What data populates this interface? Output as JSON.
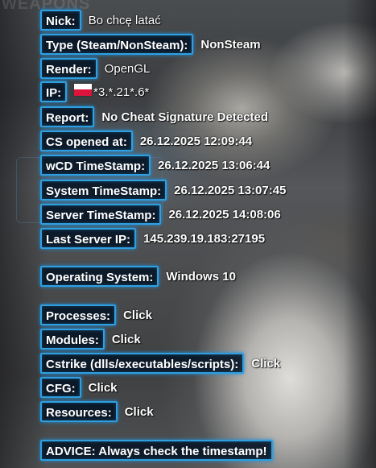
{
  "rows": {
    "nick": {
      "label": "Nick:",
      "value": "Bo chcę latać"
    },
    "type": {
      "label": "Type (Steam/NonSteam):",
      "value": "NonSteam"
    },
    "render": {
      "label": "Render:",
      "value": "OpenGL"
    },
    "ip": {
      "label": "IP:",
      "value": "*3.*.21*.6*",
      "flag": "poland-flag-icon"
    },
    "report": {
      "label": "Report:",
      "value": "No Cheat Signature Detected"
    },
    "cs_opened": {
      "label": "CS opened at:",
      "value": "26.12.2025 12:09:44"
    },
    "wcd_timestamp": {
      "label": "wCD TimeStamp:",
      "value": "26.12.2025 13:06:44"
    },
    "system_timestamp": {
      "label": "System TimeStamp:",
      "value": "26.12.2025 13:07:45"
    },
    "server_timestamp": {
      "label": "Server TimeStamp:",
      "value": "26.12.2025 14:08:06"
    },
    "last_server_ip": {
      "label": "Last Server IP:",
      "value": "145.239.19.183:27195"
    },
    "os": {
      "label": "Operating System:",
      "value": "Windows 10"
    },
    "processes": {
      "label": "Processes:",
      "value": "Click"
    },
    "modules": {
      "label": "Modules:",
      "value": "Click"
    },
    "cstrike": {
      "label": "Cstrike (dlls/executables/scripts):",
      "value": "Click"
    },
    "cfg": {
      "label": "CFG:",
      "value": "Click"
    },
    "resources": {
      "label": "Resources:",
      "value": "Click"
    },
    "advice": {
      "label": "ADVICE: Always check the timestamp!"
    }
  },
  "colors": {
    "label_border": "#2f9fe0",
    "label_bg": "#081626",
    "text": "#ffffff",
    "flag_white": "#ffffff",
    "flag_red": "#dc143c"
  }
}
